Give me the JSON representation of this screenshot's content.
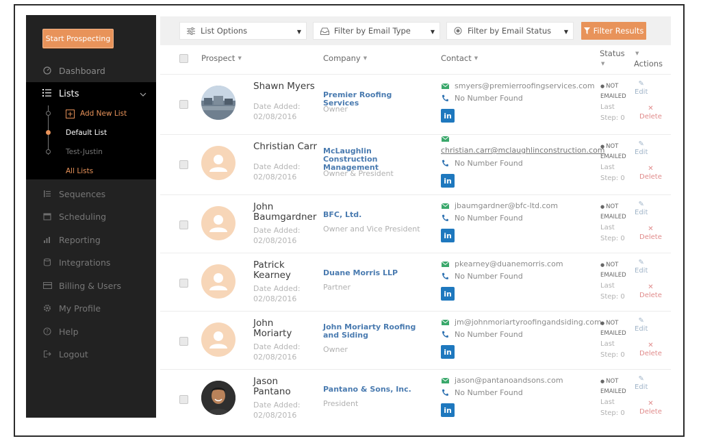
{
  "colors": {
    "accent": "#e8935a",
    "sidebar": "#222222",
    "link": "#4a7bb0",
    "linkedin": "#1e78be",
    "email_icon": "#3aa86b",
    "phone_icon": "#2a6fb0"
  },
  "sidebar": {
    "start_button": "Start Prospecting",
    "dashboard": {
      "label": "Dashboard",
      "icon": "gauge-icon"
    },
    "lists": {
      "label": "Lists",
      "icon": "list-icon"
    },
    "sub_items": {
      "add_new": "Add New List",
      "default": "Default List",
      "test": "Test-Justin",
      "all": "All Lists"
    },
    "items": [
      {
        "label": "Sequences",
        "icon": "sequences-icon"
      },
      {
        "label": "Scheduling",
        "icon": "calendar-icon"
      },
      {
        "label": "Reporting",
        "icon": "chart-icon"
      },
      {
        "label": "Integrations",
        "icon": "database-icon"
      },
      {
        "label": "Billing & Users",
        "icon": "card-icon"
      },
      {
        "label": "My Profile",
        "icon": "gear-icon"
      },
      {
        "label": "Help",
        "icon": "help-icon"
      },
      {
        "label": "Logout",
        "icon": "logout-icon"
      }
    ]
  },
  "toolbar": {
    "list_options": "List Options",
    "email_type": "Filter by Email Type",
    "email_status": "Filter by Email Status",
    "filter_button": "Filter Results"
  },
  "table": {
    "headers": {
      "prospect": "Prospect",
      "company": "Company",
      "contact": "Contact",
      "status": "Status",
      "actions": "Actions"
    },
    "rows": [
      {
        "name": "Shawn Myers",
        "date_label": "Date Added:",
        "date": "02/08/2016",
        "company": "Premier Roofing Services",
        "role": "Owner",
        "email": "smyers@premierroofingservices.com",
        "phone": "No Number Found",
        "linkedin": "in",
        "status": [
          "NOT",
          "EMAILED"
        ],
        "last": "Last",
        "step": "Step: 0",
        "edit": "Edit",
        "delete": "Delete"
      },
      {
        "name": "Christian Carr",
        "date_label": "Date Added:",
        "date": "02/08/2016",
        "company": "McLaughlin Construction Management",
        "role": "Owner & President",
        "email": "christian.carr@mclaughlinconstruction.com",
        "phone": "No Number Found",
        "linkedin": "in",
        "status": [
          "NOT",
          "EMAILED"
        ],
        "last": "Last",
        "step": "Step: 0",
        "edit": "Edit",
        "delete": "Delete"
      },
      {
        "name": "John Baumgardner",
        "date_label": "Date Added:",
        "date": "02/08/2016",
        "company": "BFC, Ltd.",
        "role": "Owner and Vice President",
        "email": "jbaumgardner@bfc-ltd.com",
        "phone": "No Number Found",
        "linkedin": "in",
        "status": [
          "NOT",
          "EMAILED"
        ],
        "last": "Last",
        "step": "Step: 0",
        "edit": "Edit",
        "delete": "Delete"
      },
      {
        "name": "Patrick Kearney",
        "date_label": "Date Added:",
        "date": "02/08/2016",
        "company": "Duane Morris LLP",
        "role": "Partner",
        "email": "pkearney@duanemorris.com",
        "phone": "No Number Found",
        "linkedin": "in",
        "status": [
          "NOT",
          "EMAILED"
        ],
        "last": "Last",
        "step": "Step: 0",
        "edit": "Edit",
        "delete": "Delete"
      },
      {
        "name": "John Moriarty",
        "date_label": "Date Added:",
        "date": "02/08/2016",
        "company": "John Moriarty Roofing and Siding",
        "role": "Owner",
        "email": "jm@johnmoriartyroofingandsiding.com",
        "phone": "No Number Found",
        "linkedin": "in",
        "status": [
          "NOT",
          "EMAILED"
        ],
        "last": "Last",
        "step": "Step: 0",
        "edit": "Edit",
        "delete": "Delete"
      },
      {
        "name": "Jason Pantano",
        "date_label": "Date Added:",
        "date": "02/08/2016",
        "company": "Pantano & Sons, Inc.",
        "role": "President",
        "email": "jason@pantanoandsons.com",
        "phone": "No Number Found",
        "linkedin": "in",
        "status": [
          "NOT",
          "EMAILED"
        ],
        "last": "Last",
        "step": "Step: 0",
        "edit": "Edit",
        "delete": "Delete"
      }
    ]
  }
}
